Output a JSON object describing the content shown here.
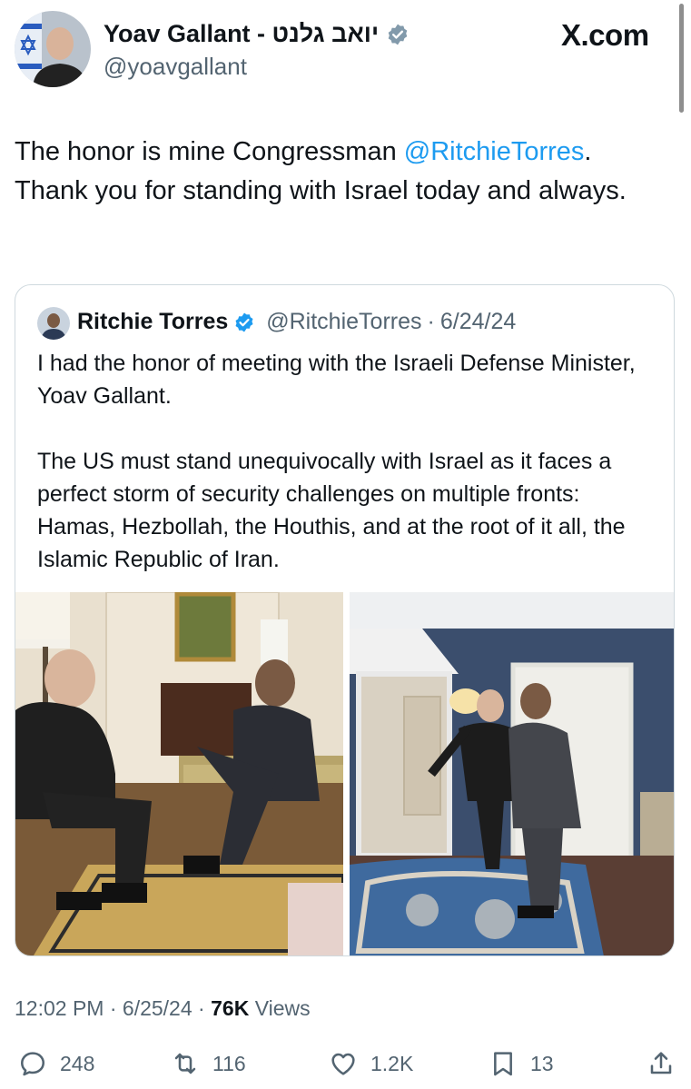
{
  "header": {
    "author_name": "Yoav Gallant - יואב גלנט",
    "handle": "@yoavgallant",
    "site_label": "X.com"
  },
  "tweet": {
    "text_before": "The honor is mine Congressman ",
    "mention": "@RitchieTorres",
    "text_after": ". Thank you for standing with Israel today and always."
  },
  "quoted_tweet": {
    "name": "Ritchie Torres",
    "handle": "@RitchieTorres",
    "separator": "·",
    "date": "6/24/24",
    "paragraph_1": "I had the honor of meeting with the Israeli Defense Minister, Yoav Gallant.",
    "paragraph_2": "The US must stand unequivocally with Israel as it faces a perfect storm of security challenges on multiple fronts: Hamas, Hezbollah, the Houthis, and at the root of it all, the Islamic Republic of Iran."
  },
  "meta": {
    "time": "12:02 PM",
    "sep1": "·",
    "date": "6/25/24",
    "sep2": "·",
    "views_count": "76K",
    "views_label": "Views"
  },
  "actions": {
    "replies": "248",
    "reposts": "116",
    "likes": "1.2K",
    "bookmarks": "13"
  },
  "colors": {
    "link": "#1d9bf0",
    "verified": "#829aab",
    "secondary_text": "#536471",
    "border": "#cfd9de"
  },
  "icons": [
    "verified-badge-icon",
    "reply-icon",
    "repost-icon",
    "like-icon",
    "bookmark-icon",
    "share-icon"
  ]
}
